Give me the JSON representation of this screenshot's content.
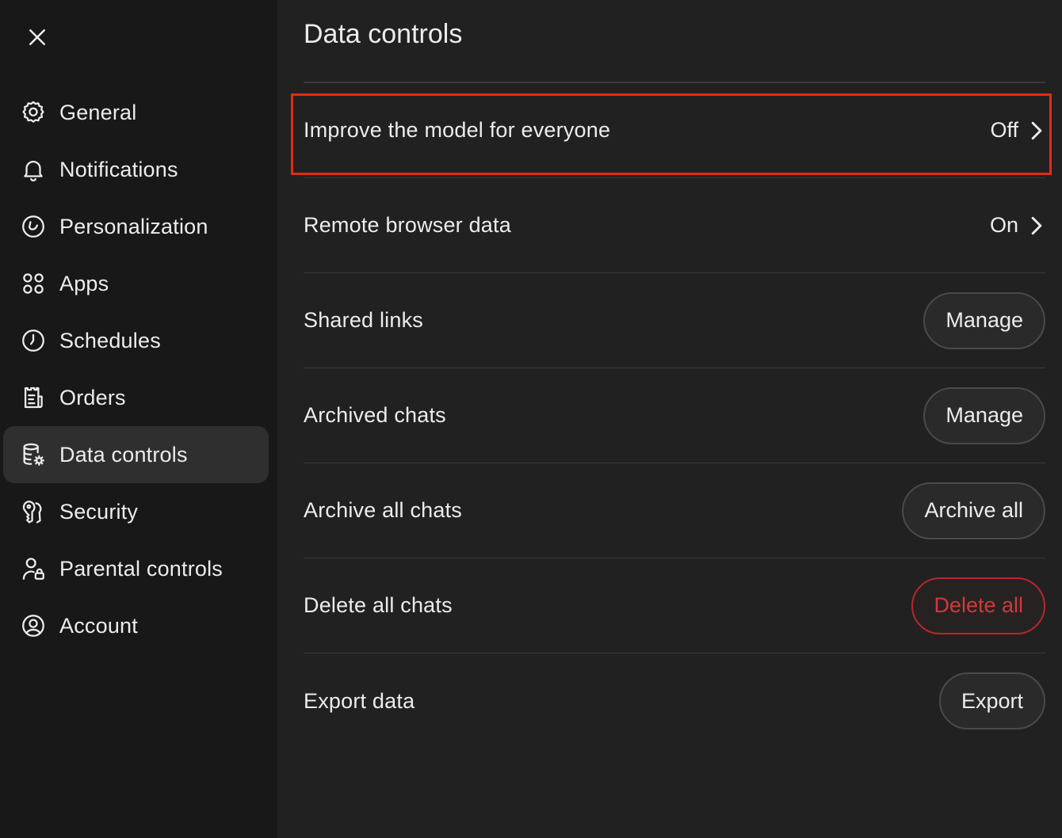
{
  "sidebar": {
    "items": [
      {
        "label": "General",
        "icon": "gear-icon",
        "active": false
      },
      {
        "label": "Notifications",
        "icon": "bell-icon",
        "active": false
      },
      {
        "label": "Personalization",
        "icon": "personalization-icon",
        "active": false
      },
      {
        "label": "Apps",
        "icon": "apps-grid-icon",
        "active": false
      },
      {
        "label": "Schedules",
        "icon": "clock-icon",
        "active": false
      },
      {
        "label": "Orders",
        "icon": "receipt-icon",
        "active": false
      },
      {
        "label": "Data controls",
        "icon": "database-gear-icon",
        "active": true
      },
      {
        "label": "Security",
        "icon": "key-icon",
        "active": false
      },
      {
        "label": "Parental controls",
        "icon": "user-lock-icon",
        "active": false
      },
      {
        "label": "Account",
        "icon": "user-circle-icon",
        "active": false
      }
    ]
  },
  "main": {
    "title": "Data controls",
    "rows": [
      {
        "label": "Improve the model for everyone",
        "value": "Off"
      },
      {
        "label": "Remote browser data",
        "value": "On"
      },
      {
        "label": "Shared links",
        "button": "Manage"
      },
      {
        "label": "Archived chats",
        "button": "Manage"
      },
      {
        "label": "Archive all chats",
        "button": "Archive all"
      },
      {
        "label": "Delete all chats",
        "button": "Delete all"
      },
      {
        "label": "Export data",
        "button": "Export"
      }
    ]
  },
  "colors": {
    "background": "#212121",
    "sidebar": "#181818",
    "active_item": "#2f2f2f",
    "danger": "#d13a3a",
    "highlight": "#e42a14"
  }
}
